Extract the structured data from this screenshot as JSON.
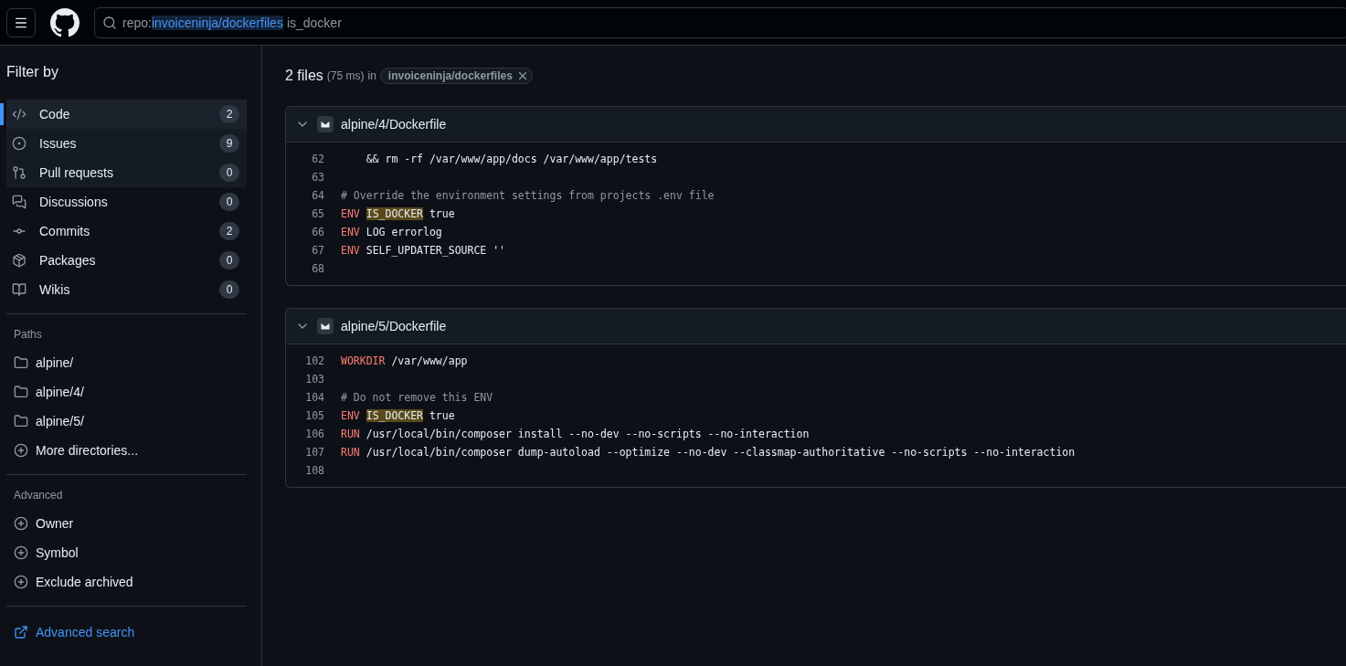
{
  "search": {
    "tokens": [
      {
        "kind": "qualifier",
        "text": "repo:"
      },
      {
        "kind": "value",
        "text": "invoiceninja/dockerfiles"
      },
      {
        "kind": "term",
        "text": "is_docker"
      }
    ]
  },
  "sidebar": {
    "title": "Filter by",
    "types": [
      {
        "label": "Code",
        "count": "2",
        "selected": true,
        "highlighted": true
      },
      {
        "label": "Issues",
        "count": "9",
        "selected": false,
        "highlighted": true
      },
      {
        "label": "Pull requests",
        "count": "0",
        "selected": false,
        "highlighted": true
      },
      {
        "label": "Discussions",
        "count": "0",
        "selected": false,
        "highlighted": false
      },
      {
        "label": "Commits",
        "count": "2",
        "selected": false,
        "highlighted": false
      },
      {
        "label": "Packages",
        "count": "0",
        "selected": false,
        "highlighted": false
      },
      {
        "label": "Wikis",
        "count": "0",
        "selected": false,
        "highlighted": false
      }
    ],
    "sections": [
      {
        "title": "Paths",
        "items": [
          {
            "kind": "folder",
            "label": "alpine/"
          },
          {
            "kind": "folder",
            "label": "alpine/4/"
          },
          {
            "kind": "folder",
            "label": "alpine/5/"
          },
          {
            "kind": "add",
            "label": "More directories..."
          }
        ]
      },
      {
        "title": "Advanced",
        "items": [
          {
            "kind": "add",
            "label": "Owner"
          },
          {
            "kind": "add",
            "label": "Symbol"
          },
          {
            "kind": "add",
            "label": "Exclude archived"
          }
        ]
      }
    ],
    "advanced_search": "Advanced search"
  },
  "results": {
    "count": "2 files",
    "timing": "(75 ms)",
    "in": "in",
    "repo_chip": "invoiceninja/dockerfiles",
    "files": [
      {
        "path": "alpine/4/Dockerfile",
        "lines": [
          {
            "number": "62",
            "tokens": [
              {
                "kind": "plain",
                "text": "    && rm -rf /var/www/app/docs /var/www/app/tests"
              }
            ]
          },
          {
            "number": "63"
          },
          {
            "number": "64",
            "tokens": [
              {
                "kind": "comment",
                "text": "# Override the environment settings from projects .env file"
              }
            ]
          },
          {
            "number": "65",
            "tokens": [
              {
                "kind": "keyword",
                "text": "ENV "
              },
              {
                "kind": "match",
                "text": "IS_DOCKER"
              },
              {
                "kind": "plain",
                "text": " true"
              }
            ]
          },
          {
            "number": "66",
            "tokens": [
              {
                "kind": "keyword",
                "text": "ENV"
              },
              {
                "kind": "plain",
                "text": " LOG errorlog"
              }
            ]
          },
          {
            "number": "67",
            "tokens": [
              {
                "kind": "keyword",
                "text": "ENV"
              },
              {
                "kind": "plain",
                "text": " SELF_UPDATER_SOURCE ''"
              }
            ]
          },
          {
            "number": "68"
          }
        ]
      },
      {
        "path": "alpine/5/Dockerfile",
        "lines": [
          {
            "number": "102",
            "tokens": [
              {
                "kind": "keyword",
                "text": "WORKDIR"
              },
              {
                "kind": "plain",
                "text": " /var/www/app"
              }
            ]
          },
          {
            "number": "103"
          },
          {
            "number": "104",
            "tokens": [
              {
                "kind": "comment",
                "text": "# Do not remove this ENV"
              }
            ]
          },
          {
            "number": "105",
            "tokens": [
              {
                "kind": "keyword",
                "text": "ENV "
              },
              {
                "kind": "match",
                "text": "IS_DOCKER"
              },
              {
                "kind": "plain",
                "text": " true"
              }
            ]
          },
          {
            "number": "106",
            "tokens": [
              {
                "kind": "keyword",
                "text": "RUN"
              },
              {
                "kind": "plain",
                "text": " /usr/local/bin/composer install --no-dev --no-scripts --no-interaction"
              }
            ]
          },
          {
            "number": "107",
            "tokens": [
              {
                "kind": "keyword",
                "text": "RUN"
              },
              {
                "kind": "plain",
                "text": " /usr/local/bin/composer dump-autoload --optimize --no-dev --classmap-authoritative --no-scripts --no-interaction"
              }
            ]
          },
          {
            "number": "108"
          }
        ]
      }
    ]
  }
}
